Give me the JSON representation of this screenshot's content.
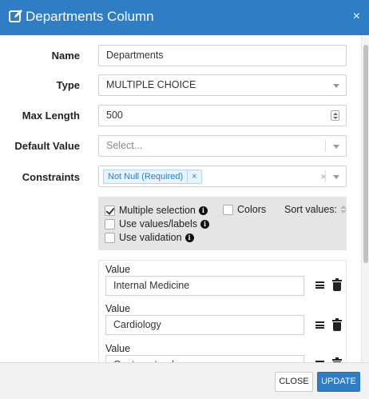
{
  "modal": {
    "title": "Departments Column",
    "close_label": "×"
  },
  "form": {
    "name": {
      "label": "Name",
      "value": "Departments"
    },
    "type": {
      "label": "Type",
      "value": "MULTIPLE CHOICE"
    },
    "max_length": {
      "label": "Max Length",
      "value": "500"
    },
    "default_value": {
      "label": "Default Value",
      "placeholder": "Select..."
    },
    "constraints": {
      "label": "Constraints",
      "tag": "Not Null (Required)",
      "tag_remove": "×",
      "clear": "×"
    }
  },
  "options": {
    "multiple_selection": {
      "label": "Multiple selection",
      "checked": true
    },
    "use_values_labels": {
      "label": "Use values/labels",
      "checked": false
    },
    "use_validation": {
      "label": "Use validation",
      "checked": false
    },
    "colors": {
      "label": "Colors",
      "checked": false
    },
    "sort_values": {
      "label": "Sort values:"
    },
    "info_glyph": "i"
  },
  "values": {
    "label": "Value",
    "items": [
      {
        "value": "Internal Medicine"
      },
      {
        "value": "Cardiology"
      },
      {
        "value": "Gastroenterology"
      }
    ]
  },
  "footer": {
    "close_label": "CLOSE",
    "update_label": "UPDATE"
  },
  "colors": {
    "header": "#2f7dc4",
    "primary_button": "#2f7dc4",
    "tag_bg": "#e8f3fc"
  },
  "icons": [
    "edit-icon",
    "close-icon",
    "chevron-down-icon",
    "spinner-icon",
    "info-icon",
    "reorder-icon",
    "trash-icon"
  ]
}
